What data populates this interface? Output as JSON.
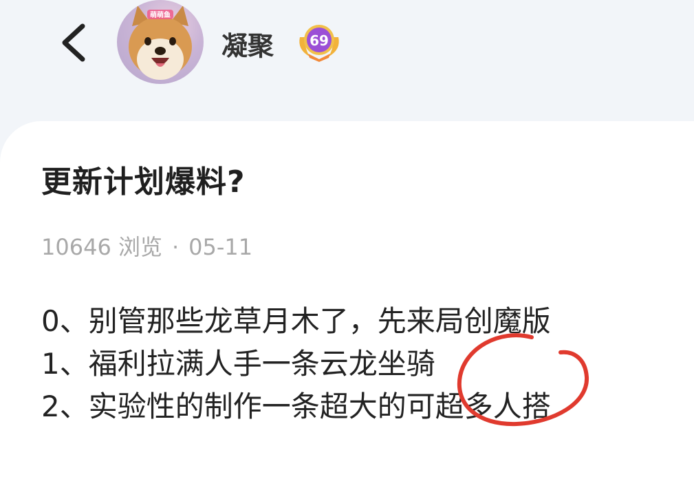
{
  "header": {
    "username": "凝聚",
    "level": "69",
    "avatar_tag": "萌萌鱼"
  },
  "post": {
    "title": "更新计划爆料?",
    "views": "10646 浏览",
    "separator": "·",
    "date": "05-11",
    "lines": [
      "0、别管那些龙草月木了，先来局创魔版",
      "1、福利拉满人手一条云龙坐骑",
      "2、实验性的制作一条超大的可超多人搭"
    ]
  },
  "colors": {
    "background": "#f2f5f9",
    "card": "#ffffff",
    "annotation": "#e03a2e",
    "badge": "#9b4fd6",
    "meta_text": "#a8a8a8"
  }
}
